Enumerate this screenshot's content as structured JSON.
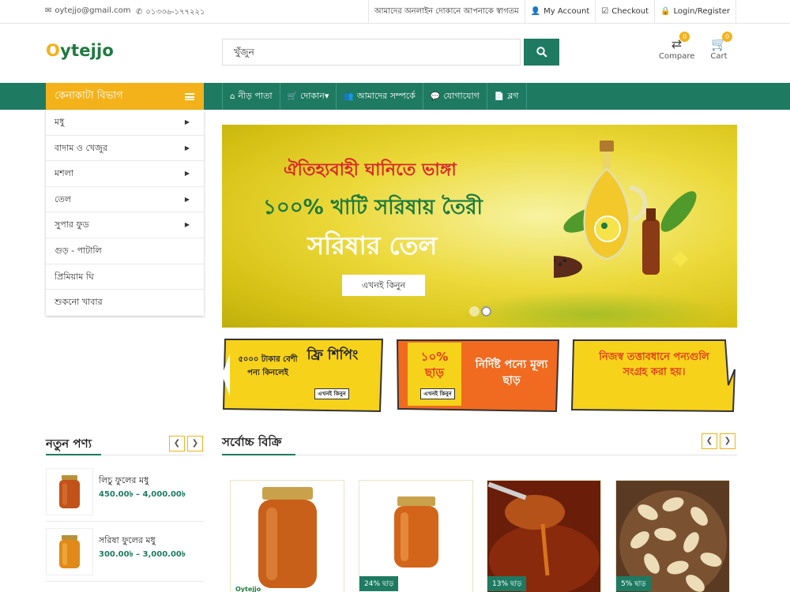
{
  "topbar": {
    "email": "oytejjo@gmail.com",
    "phone": "০১৩৩৬-১৭৭২২১",
    "welcome": "আমাদের অনলাইন দোকানে আপনাকে স্বাগতম",
    "account": "My Account",
    "checkout": "Checkout",
    "login": "Login/Register"
  },
  "header": {
    "logo_o": "O",
    "logo_rest": "ytejjo",
    "search_value": "খুঁজুন",
    "compare_label": "Compare",
    "compare_count": "0",
    "cart_label": "Cart",
    "cart_count": "0"
  },
  "nav": {
    "category_heading": "কেনাকাটা বিভাগ",
    "items": [
      {
        "label": "নীড় পাতা",
        "icon": "home-icon"
      },
      {
        "label": "দোকান▾",
        "icon": "cart-icon"
      },
      {
        "label": "আমাদের সম্পর্কে",
        "icon": "users-icon"
      },
      {
        "label": "যোগাযোগ",
        "icon": "chat-icon"
      },
      {
        "label": "ব্লগ",
        "icon": "document-icon"
      }
    ]
  },
  "categories": [
    {
      "label": "মধু",
      "has_sub": true
    },
    {
      "label": "বাদাম ও খেজুর",
      "has_sub": true
    },
    {
      "label": "মশলা",
      "has_sub": true
    },
    {
      "label": "তেল",
      "has_sub": true
    },
    {
      "label": "সুপার ফুড",
      "has_sub": true
    },
    {
      "label": "গুড় - পাটালি",
      "has_sub": false
    },
    {
      "label": "প্রিমিয়াম ঘি",
      "has_sub": false
    },
    {
      "label": "শুকনো খাবার",
      "has_sub": false
    }
  ],
  "hero": {
    "line1": "ঐতিহ্যবাহী ঘানিতে ভাঙ্গা",
    "line2": "১০০% খাটি সরিষায় তৈরী",
    "line3": "সরিষার তেল",
    "button": "এখনই কিনুন"
  },
  "promos": [
    {
      "left": "৫০০০ টাকার বেশী পন্য কিনলেই",
      "right": "ফ্রি শিপিং",
      "button": "এখনই কিনুন"
    },
    {
      "left": "১০% ছাড়",
      "right": "নির্দিষ্ট পন্যে মূল্য ছাড়",
      "button": "এখনই কিনুন"
    },
    {
      "text": "নিজস্ব তত্তাবধানে পন্যগুলি সংগ্রহ করা হয়।"
    }
  ],
  "new_products": {
    "title": "নতুন পণ্য",
    "items": [
      {
        "name": "লিচু ফুলের মধু",
        "price": "450.00৳ – 4,000.00৳"
      },
      {
        "name": "সরিষা ফুলের মধু",
        "price": "300.00৳ – 3,000.00৳"
      }
    ]
  },
  "best_sellers": {
    "title": "সর্বোচ্চ বিক্রি",
    "cards": [
      {
        "discount": "",
        "logo": "Oytejjo"
      },
      {
        "discount": "24% ছাড়"
      },
      {
        "discount": "13% ছাড়"
      },
      {
        "discount": "5% ছাড়"
      }
    ]
  },
  "colors": {
    "brand_green": "#1e7a61",
    "brand_yellow": "#f3b21a",
    "hero_red": "#d9262b"
  }
}
